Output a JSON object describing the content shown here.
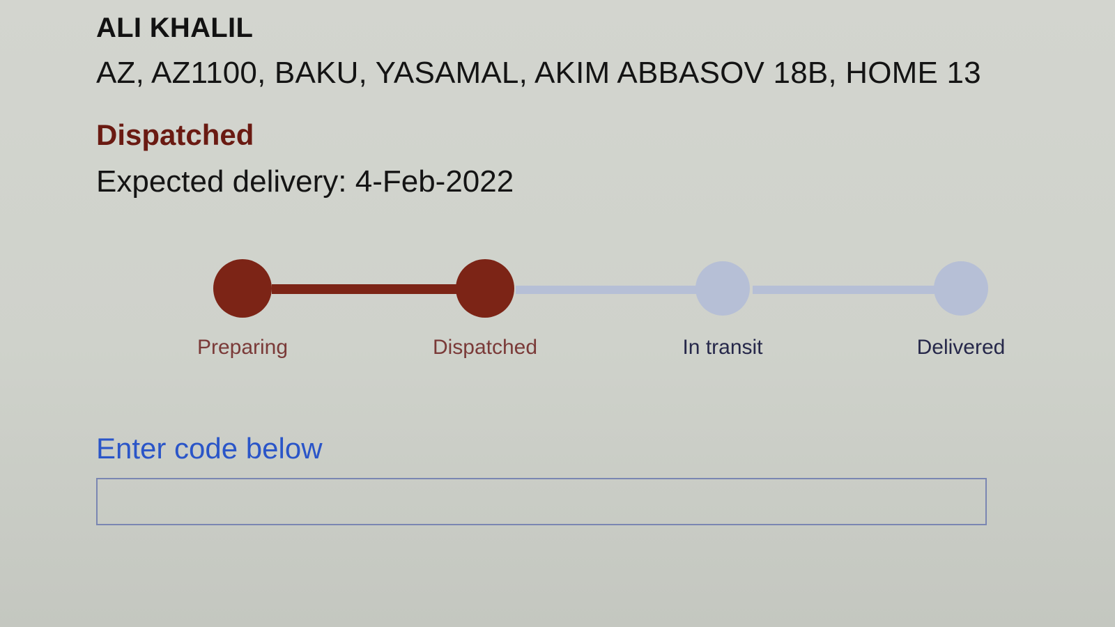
{
  "recipient": {
    "name": "ALI KHALIL",
    "address": "AZ, AZ1100, BAKU, YASAMAL, AKIM ABBASOV 18B, HOME 13"
  },
  "status": {
    "current": "Dispatched",
    "expected_delivery": "Expected delivery: 4-Feb-2022"
  },
  "tracker": {
    "steps": [
      {
        "label": "Preparing",
        "state": "done"
      },
      {
        "label": "Dispatched",
        "state": "done"
      },
      {
        "label": "In transit",
        "state": "pending"
      },
      {
        "label": "Delivered",
        "state": "pending"
      }
    ],
    "colors": {
      "done": "#7c2416",
      "pending": "#b6bfd6"
    }
  },
  "code_entry": {
    "label": "Enter code below",
    "value": "",
    "placeholder": ""
  }
}
